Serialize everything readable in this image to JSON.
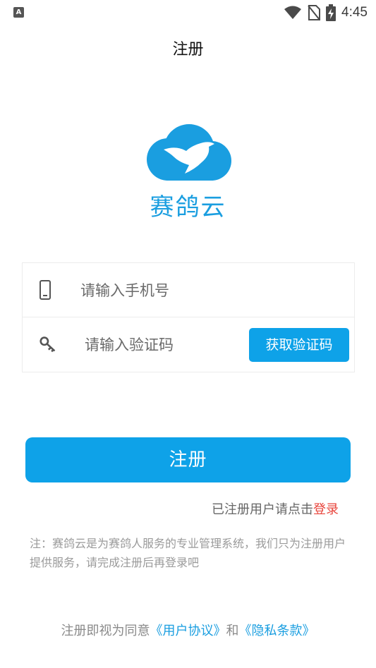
{
  "status_bar": {
    "app_badge": "A",
    "time": "4:45",
    "icons": [
      "wifi-icon",
      "no-sim-icon",
      "battery-charging-icon"
    ]
  },
  "header": {
    "title": "注册"
  },
  "brand": {
    "name": "赛鸽云",
    "color": "#1a9ee0"
  },
  "form": {
    "phone_placeholder": "请输入手机号",
    "code_placeholder": "请输入验证码",
    "get_code_label": "获取验证码",
    "phone_icon": "phone-icon",
    "key_icon": "key-icon"
  },
  "submit": {
    "label": "注册"
  },
  "login_prompt": {
    "text": "已注册用户请点击",
    "link": "登录"
  },
  "note": "注：赛鸽云是为赛鸽人服务的专业管理系统，我们只为注册用户提供服务，请完成注册后再登录吧",
  "agreement": {
    "prefix": "注册即视为同意",
    "user_agreement": "《用户协议》",
    "and": "和",
    "privacy_policy": "《隐私条款》"
  },
  "colors": {
    "accent": "#0ea2e8",
    "link_red": "#e8453c"
  }
}
